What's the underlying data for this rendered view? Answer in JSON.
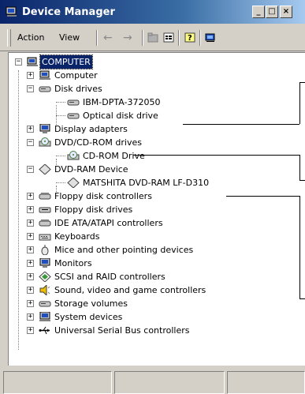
{
  "window": {
    "title": "Device Manager",
    "minimize_glyph": "_",
    "maximize_glyph": "□",
    "close_glyph": "×"
  },
  "menu": {
    "action": "Action",
    "view": "View"
  },
  "toolbar": {
    "back_glyph": "←",
    "forward_glyph": "→"
  },
  "tree": {
    "root": "COMPUTER",
    "items": [
      "Computer",
      "Disk drives",
      "IBM-DPTA-372050",
      "Optical disk drive",
      "Display adapters",
      "DVD/CD-ROM drives",
      "CD-ROM Drive",
      "DVD-RAM Device",
      "MATSHITA DVD-RAM LF-D310",
      "Floppy disk controllers",
      "Floppy disk drives",
      "IDE ATA/ATAPI controllers",
      "Keyboards",
      "Mice and other pointing devices",
      "Monitors",
      "SCSI and RAID controllers",
      "Sound, video and game controllers",
      "Storage volumes",
      "System devices",
      "Universal Serial Bus controllers"
    ]
  },
  "colors": {
    "title_start": "#0a246a",
    "title_end": "#a6caf0",
    "selection": "#0a246a",
    "face": "#d4d0c8"
  }
}
